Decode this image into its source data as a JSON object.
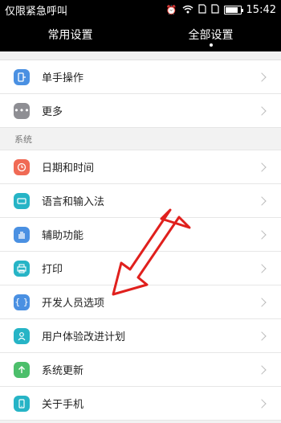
{
  "status_bar": {
    "carrier": "仅限紧急呼叫",
    "time": "15:42",
    "battery_level": 0.85
  },
  "tabs": [
    {
      "label": "常用设置",
      "active": false
    },
    {
      "label": "全部设置",
      "active": true
    }
  ],
  "items_top": [
    {
      "label": "单手操作",
      "icon": "one-hand-icon",
      "color": "#4a90e2"
    },
    {
      "label": "更多",
      "icon": "more-icon",
      "color": "#8e8e93"
    }
  ],
  "section": {
    "title": "系统"
  },
  "items_system": [
    {
      "label": "日期和时间",
      "icon": "clock-icon",
      "color": "#f06a55"
    },
    {
      "label": "语言和输入法",
      "icon": "keyboard-icon",
      "color": "#26b4c6"
    },
    {
      "label": "辅助功能",
      "icon": "hand-icon",
      "color": "#4a90e2"
    },
    {
      "label": "打印",
      "icon": "printer-icon",
      "color": "#26b4c6"
    },
    {
      "label": "开发人员选项",
      "icon": "braces-icon",
      "color": "#4a90e2"
    },
    {
      "label": "用户体验改进计划",
      "icon": "user-icon",
      "color": "#26b4c6"
    },
    {
      "label": "系统更新",
      "icon": "up-arrow-icon",
      "color": "#4cbf6b"
    },
    {
      "label": "关于手机",
      "icon": "phone-icon",
      "color": "#26b4c6"
    }
  ],
  "annotation": {
    "color": "#e0201d"
  }
}
